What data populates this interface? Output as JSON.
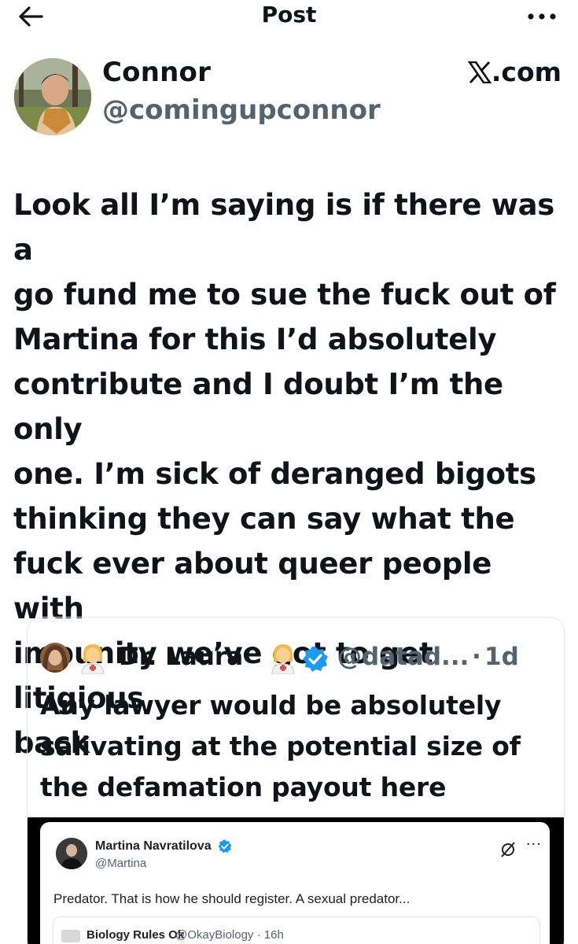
{
  "header": {
    "title": "Post",
    "back_icon": "arrow-left-icon",
    "more_icon": "more-horizontal-icon"
  },
  "author": {
    "name": "Connor",
    "handle": "@comingupconnor",
    "source": ".com",
    "source_icon": "x-logo-icon"
  },
  "tweet": {
    "lines": [
      "Look all I’m saying is if there was a",
      "go fund me to sue the fuck out of",
      "Martina for this I’d absolutely",
      "contribute and I doubt I’m the only",
      "one. I’m sick of deranged bigots",
      "thinking they can say what the",
      "fuck ever about queer people with",
      "impunity we’ve got to get litigious",
      "back"
    ]
  },
  "quote": {
    "name": "Dr. Laura",
    "handle": "@datad...",
    "separator": "·",
    "time": "1d",
    "verified_color": "#1d9bf0",
    "emoji_icon": "woman-health-worker-emoji-icon",
    "lines": [
      "Any lawyer would be absolutely",
      "salivating at the potential size of",
      "the defamation payout here"
    ],
    "media": {
      "name": "Martina Navratilova",
      "handle": "@Martina",
      "more": "···",
      "text": "Predator. That is how he should register. A sexual predator...",
      "quoted": {
        "name": "Biology Rules Ok",
        "handle": "@OkayBiology · 16h"
      }
    }
  },
  "colors": {
    "text": "#0f1419",
    "secondary": "#536471",
    "verified": "#1d9bf0",
    "border": "#e4e8eb"
  }
}
